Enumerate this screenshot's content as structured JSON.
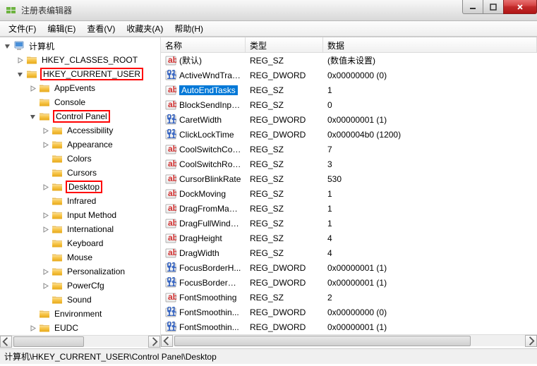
{
  "window": {
    "title": "注册表编辑器"
  },
  "menu": {
    "file": "文件(F)",
    "edit": "编辑(E)",
    "view": "查看(V)",
    "favorites": "收藏夹(A)",
    "help": "帮助(H)"
  },
  "tree": {
    "root": "计算机",
    "items": [
      {
        "indent": 1,
        "toggle": "closed",
        "label": "HKEY_CLASSES_ROOT",
        "hl": false
      },
      {
        "indent": 1,
        "toggle": "open",
        "label": "HKEY_CURRENT_USER",
        "hl": true
      },
      {
        "indent": 2,
        "toggle": "closed",
        "label": "AppEvents",
        "hl": false
      },
      {
        "indent": 2,
        "toggle": "none",
        "label": "Console",
        "hl": false
      },
      {
        "indent": 2,
        "toggle": "open",
        "label": "Control Panel",
        "hl": true
      },
      {
        "indent": 3,
        "toggle": "closed",
        "label": "Accessibility",
        "hl": false
      },
      {
        "indent": 3,
        "toggle": "closed",
        "label": "Appearance",
        "hl": false
      },
      {
        "indent": 3,
        "toggle": "none",
        "label": "Colors",
        "hl": false
      },
      {
        "indent": 3,
        "toggle": "none",
        "label": "Cursors",
        "hl": false
      },
      {
        "indent": 3,
        "toggle": "closed",
        "label": "Desktop",
        "hl": true
      },
      {
        "indent": 3,
        "toggle": "none",
        "label": "Infrared",
        "hl": false
      },
      {
        "indent": 3,
        "toggle": "closed",
        "label": "Input Method",
        "hl": false
      },
      {
        "indent": 3,
        "toggle": "closed",
        "label": "International",
        "hl": false
      },
      {
        "indent": 3,
        "toggle": "none",
        "label": "Keyboard",
        "hl": false
      },
      {
        "indent": 3,
        "toggle": "none",
        "label": "Mouse",
        "hl": false
      },
      {
        "indent": 3,
        "toggle": "closed",
        "label": "Personalization",
        "hl": false
      },
      {
        "indent": 3,
        "toggle": "closed",
        "label": "PowerCfg",
        "hl": false
      },
      {
        "indent": 3,
        "toggle": "none",
        "label": "Sound",
        "hl": false
      },
      {
        "indent": 2,
        "toggle": "none",
        "label": "Environment",
        "hl": false
      },
      {
        "indent": 2,
        "toggle": "closed",
        "label": "EUDC",
        "hl": false
      }
    ]
  },
  "list": {
    "headers": {
      "name": "名称",
      "type": "类型",
      "data": "数据"
    },
    "rows": [
      {
        "icon": "sz",
        "name": "(默认)",
        "type": "REG_SZ",
        "data": "(数值未设置)",
        "selected": false
      },
      {
        "icon": "dw",
        "name": "ActiveWndTrac...",
        "type": "REG_DWORD",
        "data": "0x00000000 (0)",
        "selected": false
      },
      {
        "icon": "sz",
        "name": "AutoEndTasks",
        "type": "REG_SZ",
        "data": "1",
        "selected": true
      },
      {
        "icon": "sz",
        "name": "BlockSendInpu...",
        "type": "REG_SZ",
        "data": "0",
        "selected": false
      },
      {
        "icon": "dw",
        "name": "CaretWidth",
        "type": "REG_DWORD",
        "data": "0x00000001 (1)",
        "selected": false
      },
      {
        "icon": "dw",
        "name": "ClickLockTime",
        "type": "REG_DWORD",
        "data": "0x000004b0 (1200)",
        "selected": false
      },
      {
        "icon": "sz",
        "name": "CoolSwitchCol...",
        "type": "REG_SZ",
        "data": "7",
        "selected": false
      },
      {
        "icon": "sz",
        "name": "CoolSwitchRows",
        "type": "REG_SZ",
        "data": "3",
        "selected": false
      },
      {
        "icon": "sz",
        "name": "CursorBlinkRate",
        "type": "REG_SZ",
        "data": "530",
        "selected": false
      },
      {
        "icon": "sz",
        "name": "DockMoving",
        "type": "REG_SZ",
        "data": "1",
        "selected": false
      },
      {
        "icon": "sz",
        "name": "DragFromMaxi...",
        "type": "REG_SZ",
        "data": "1",
        "selected": false
      },
      {
        "icon": "sz",
        "name": "DragFullWindo...",
        "type": "REG_SZ",
        "data": "1",
        "selected": false
      },
      {
        "icon": "sz",
        "name": "DragHeight",
        "type": "REG_SZ",
        "data": "4",
        "selected": false
      },
      {
        "icon": "sz",
        "name": "DragWidth",
        "type": "REG_SZ",
        "data": "4",
        "selected": false
      },
      {
        "icon": "dw",
        "name": "FocusBorderH...",
        "type": "REG_DWORD",
        "data": "0x00000001 (1)",
        "selected": false
      },
      {
        "icon": "dw",
        "name": "FocusBorderW...",
        "type": "REG_DWORD",
        "data": "0x00000001 (1)",
        "selected": false
      },
      {
        "icon": "sz",
        "name": "FontSmoothing",
        "type": "REG_SZ",
        "data": "2",
        "selected": false
      },
      {
        "icon": "dw",
        "name": "FontSmoothin...",
        "type": "REG_DWORD",
        "data": "0x00000000 (0)",
        "selected": false
      },
      {
        "icon": "dw",
        "name": "FontSmoothin...",
        "type": "REG_DWORD",
        "data": "0x00000001 (1)",
        "selected": false
      }
    ]
  },
  "statusbar": {
    "path": "计算机\\HKEY_CURRENT_USER\\Control Panel\\Desktop"
  }
}
